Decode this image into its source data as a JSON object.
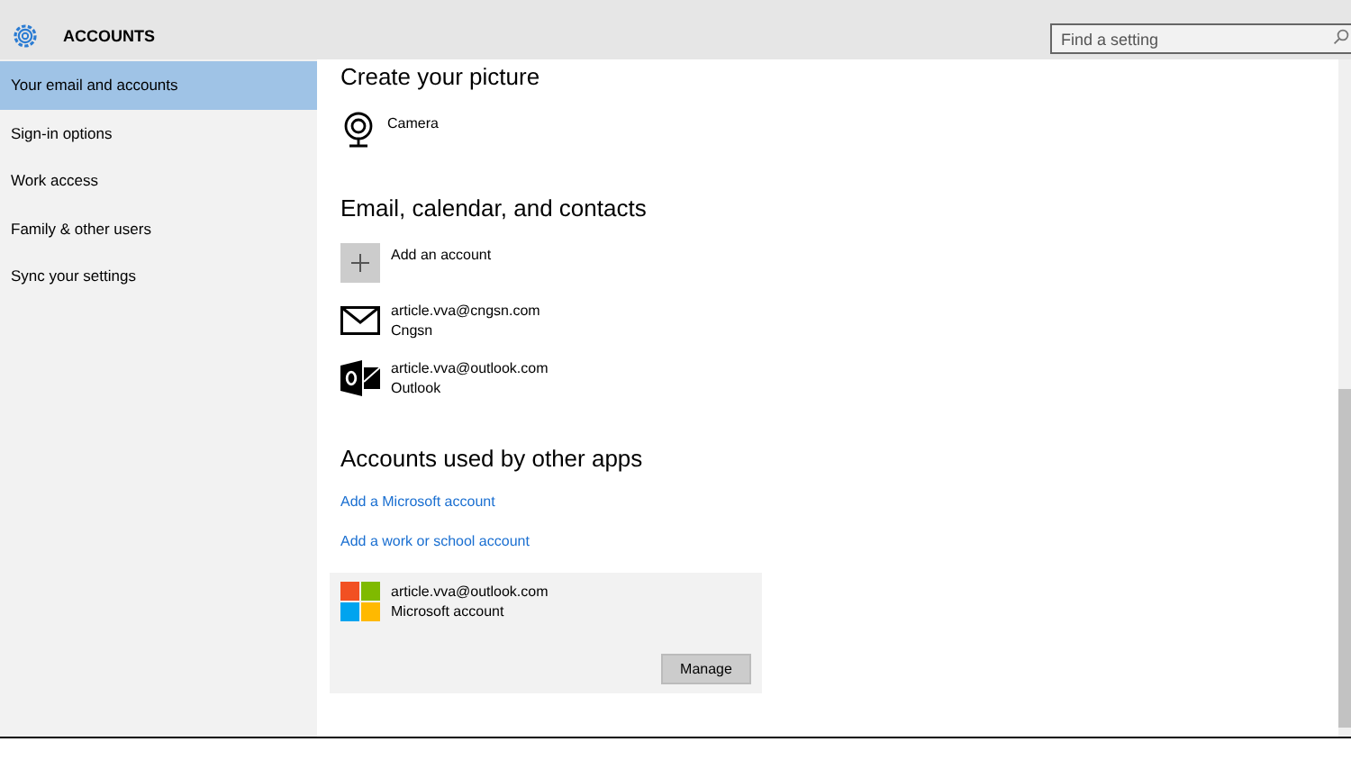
{
  "header": {
    "title": "ACCOUNTS"
  },
  "search": {
    "placeholder": "Find a setting"
  },
  "sidebar": {
    "items": [
      {
        "label": "Your email and accounts",
        "selected": true
      },
      {
        "label": "Sign-in options",
        "selected": false
      },
      {
        "label": "Work access",
        "selected": false
      },
      {
        "label": "Family & other users",
        "selected": false
      },
      {
        "label": "Sync your settings",
        "selected": false
      }
    ]
  },
  "picture_section": {
    "heading": "Create your picture",
    "options": [
      {
        "kind": "camera",
        "label": "Camera"
      }
    ]
  },
  "email_section": {
    "heading": "Email, calendar, and contacts",
    "add_label": "Add an account",
    "accounts": [
      {
        "kind": "mail",
        "address": "article.vva@cngsn.com",
        "provider": "Cngsn"
      },
      {
        "kind": "outlook",
        "address": "article.vva@outlook.com",
        "provider": "Outlook"
      }
    ]
  },
  "apps_section": {
    "heading": "Accounts used by other apps",
    "links": [
      "Add a Microsoft account",
      "Add a work or school account"
    ],
    "account": {
      "address": "article.vva@outlook.com",
      "type": "Microsoft account",
      "button": "Manage"
    }
  }
}
